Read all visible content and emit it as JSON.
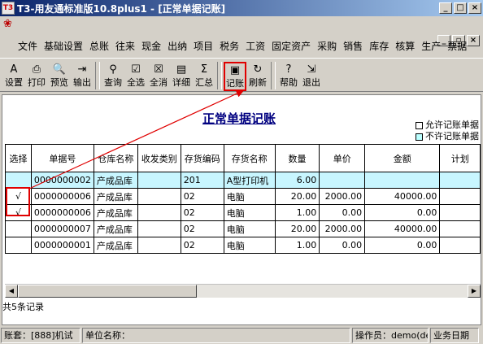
{
  "window": {
    "title": "T3-用友通标准版10.8plus1 - [正常单据记账]",
    "app_icon": "T3",
    "controls": {
      "minimize": "_",
      "maximize": "□",
      "close": "×"
    },
    "mdi_controls": {
      "minimize": "_",
      "restore": "▫",
      "close": "×"
    }
  },
  "menu": [
    "文件",
    "基础设置",
    "总账",
    "往来",
    "现金",
    "出纳",
    "项目",
    "税务",
    "工资",
    "固定资产",
    "采购",
    "销售",
    "库存",
    "核算",
    "生产",
    "票据"
  ],
  "toolbar": [
    {
      "label": "设置",
      "icon": "settings-icon",
      "glyph": "A"
    },
    {
      "label": "打印",
      "icon": "printer-icon",
      "glyph": "⎙"
    },
    {
      "label": "预览",
      "icon": "preview-icon",
      "glyph": "🔍"
    },
    {
      "label": "输出",
      "icon": "export-icon",
      "glyph": "⇥"
    },
    {
      "label": "查询",
      "icon": "binoculars-icon",
      "glyph": "⚲"
    },
    {
      "label": "全选",
      "icon": "select-all-icon",
      "glyph": "☑"
    },
    {
      "label": "全消",
      "icon": "deselect-all-icon",
      "glyph": "☒"
    },
    {
      "label": "详细",
      "icon": "detail-icon",
      "glyph": "▤"
    },
    {
      "label": "汇总",
      "icon": "summary-icon",
      "glyph": "Σ"
    },
    {
      "label": "记账",
      "icon": "post-ledger-icon",
      "glyph": "▣"
    },
    {
      "label": "刷新",
      "icon": "refresh-icon",
      "glyph": "↻"
    },
    {
      "label": "帮助",
      "icon": "help-icon",
      "glyph": "?"
    },
    {
      "label": "退出",
      "icon": "exit-icon",
      "glyph": "⇲"
    }
  ],
  "document": {
    "title": "正常单据记账",
    "legend": [
      {
        "label": "允许记账单据",
        "color": "#ffffff"
      },
      {
        "label": "不许记账单据",
        "color": "#bbffff"
      }
    ]
  },
  "table": {
    "columns": [
      "选择",
      "单据号",
      "仓库名称",
      "收发类别",
      "存货编码",
      "存货名称",
      "数量",
      "单价",
      "金额",
      "计划"
    ],
    "rows": [
      {
        "select": "",
        "doc_no": "0000000002",
        "warehouse": "产成品库",
        "category": "",
        "code": "201",
        "name": "A型打印机",
        "qty": "6.00",
        "price": "",
        "amount": "",
        "plan": ""
      },
      {
        "select": "√",
        "doc_no": "0000000006",
        "warehouse": "产成品库",
        "category": "",
        "code": "02",
        "name": "电脑",
        "qty": "20.00",
        "price": "2000.00",
        "amount": "40000.00",
        "plan": ""
      },
      {
        "select": "√",
        "doc_no": "0000000006",
        "warehouse": "产成品库",
        "category": "",
        "code": "02",
        "name": "电脑",
        "qty": "1.00",
        "price": "0.00",
        "amount": "0.00",
        "plan": ""
      },
      {
        "select": "",
        "doc_no": "0000000007",
        "warehouse": "产成品库",
        "category": "",
        "code": "02",
        "name": "电脑",
        "qty": "20.00",
        "price": "2000.00",
        "amount": "40000.00",
        "plan": ""
      },
      {
        "select": "",
        "doc_no": "0000000001",
        "warehouse": "产成品库",
        "category": "",
        "code": "02",
        "name": "电脑",
        "qty": "1.00",
        "price": "0.00",
        "amount": "0.00",
        "plan": ""
      }
    ],
    "record_count": "共5条记录"
  },
  "status": {
    "account_set": "账套：[888]机试",
    "unit": "单位名称：",
    "operator": "操作员：demo(de",
    "business_date": "业务日期"
  },
  "colors": {
    "highlight": "#e00000",
    "selected_row": "#c8f6ff",
    "title_blue": "#000080"
  }
}
